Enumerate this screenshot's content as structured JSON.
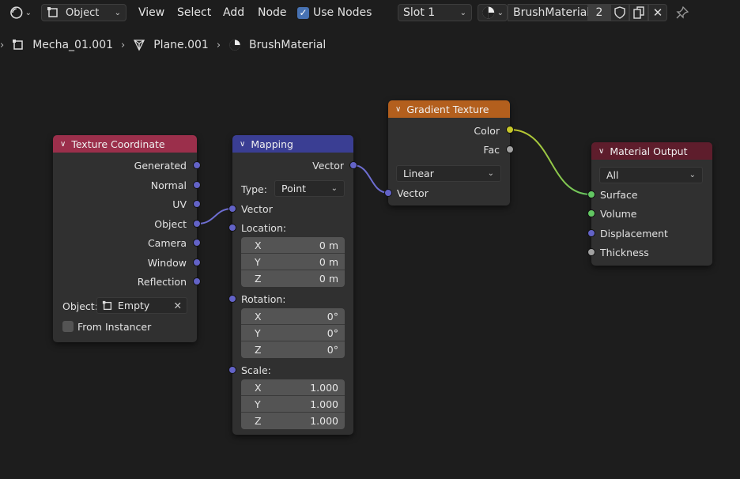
{
  "header": {
    "mode": "Object",
    "menu": [
      "View",
      "Select",
      "Add",
      "Node"
    ],
    "use_nodes_label": "Use Nodes",
    "slot": "Slot 1",
    "material_name": "BrushMaterial",
    "users_count": "2"
  },
  "breadcrumb": {
    "object": "Mecha_01.001",
    "mesh": "Plane.001",
    "material": "BrushMaterial"
  },
  "nodes": {
    "texcoord": {
      "title": "Texture Coordinate",
      "outputs": [
        "Generated",
        "Normal",
        "UV",
        "Object",
        "Camera",
        "Window",
        "Reflection"
      ],
      "object_label": "Object:",
      "object_value": "Empty",
      "from_instancer": "From Instancer"
    },
    "mapping": {
      "title": "Mapping",
      "output": "Vector",
      "type_label": "Type:",
      "type_value": "Point",
      "vector_input": "Vector",
      "location_label": "Location:",
      "location": [
        {
          "axis": "X",
          "value": "0 m"
        },
        {
          "axis": "Y",
          "value": "0 m"
        },
        {
          "axis": "Z",
          "value": "0 m"
        }
      ],
      "rotation_label": "Rotation:",
      "rotation": [
        {
          "axis": "X",
          "value": "0°"
        },
        {
          "axis": "Y",
          "value": "0°"
        },
        {
          "axis": "Z",
          "value": "0°"
        }
      ],
      "scale_label": "Scale:",
      "scale": [
        {
          "axis": "X",
          "value": "1.000"
        },
        {
          "axis": "Y",
          "value": "1.000"
        },
        {
          "axis": "Z",
          "value": "1.000"
        }
      ]
    },
    "gradient": {
      "title": "Gradient Texture",
      "outputs": [
        "Color",
        "Fac"
      ],
      "type_value": "Linear",
      "input": "Vector"
    },
    "output": {
      "title": "Material Output",
      "target": "All",
      "inputs": [
        "Surface",
        "Volume",
        "Displacement",
        "Thickness"
      ]
    }
  },
  "colors": {
    "texcoord_header": "#9b2f4b",
    "mapping_header": "#3a3e93",
    "gradient_header": "#b35f1d",
    "output_header": "#5e1d2c",
    "vector_socket": "#6363c7",
    "color_socket": "#c7c729",
    "shader_socket": "#63c763"
  }
}
